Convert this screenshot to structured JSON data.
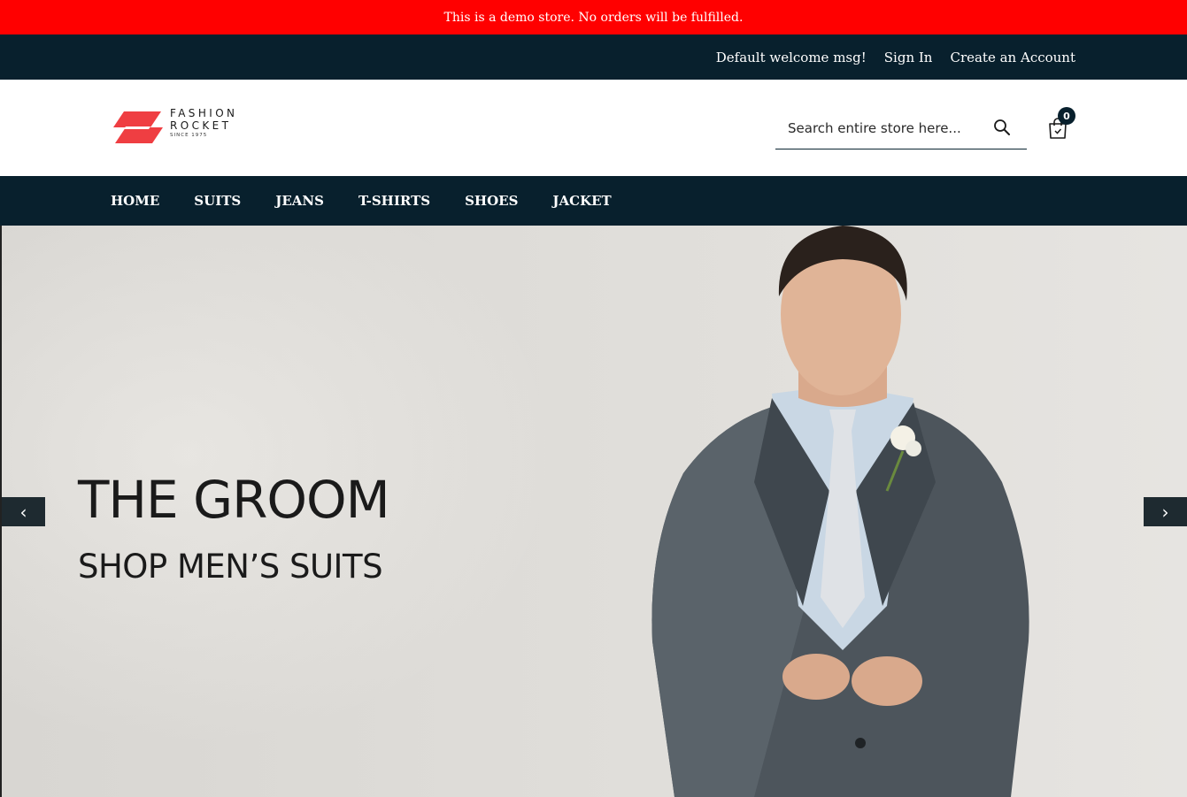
{
  "demo_notice": "This is a demo store. No orders will be fulfilled.",
  "top_bar": {
    "welcome": "Default welcome msg!",
    "sign_in": "Sign In",
    "create_account": "Create an Account"
  },
  "logo": {
    "line1": "FASHION",
    "line2": "ROCKET",
    "line3": "SINCE 1975"
  },
  "search": {
    "placeholder": "Search entire store here..."
  },
  "cart": {
    "count": "0"
  },
  "nav": {
    "items": [
      "HOME",
      "SUITS",
      "JEANS",
      "T-SHIRTS",
      "SHOES",
      "JACKET"
    ]
  },
  "hero": {
    "title": "THE GROOM",
    "subtitle": "SHOP MEN’S SUITS",
    "prev_label": "‹",
    "next_label": "›"
  },
  "colors": {
    "demo_bar": "#ff0000",
    "navy": "#08202d",
    "logo_red": "#ef3e42"
  }
}
